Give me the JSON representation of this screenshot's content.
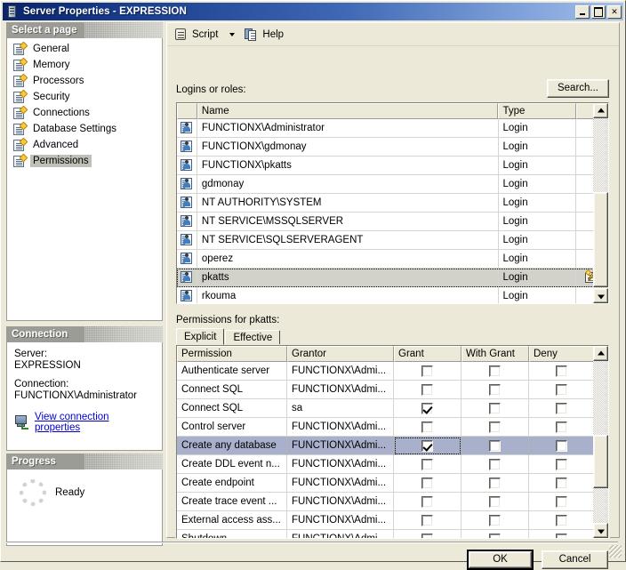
{
  "window": {
    "title": "Server Properties - EXPRESSION",
    "icon": "server-icon",
    "minimize_label": "Minimize",
    "maximize_label": "Maximize",
    "close_label": "✕"
  },
  "sidebar": {
    "header": "Select a page",
    "items": [
      {
        "label": "General",
        "selected": false
      },
      {
        "label": "Memory",
        "selected": false
      },
      {
        "label": "Processors",
        "selected": false
      },
      {
        "label": "Security",
        "selected": false
      },
      {
        "label": "Connections",
        "selected": false
      },
      {
        "label": "Database Settings",
        "selected": false
      },
      {
        "label": "Advanced",
        "selected": false
      },
      {
        "label": "Permissions",
        "selected": true
      }
    ]
  },
  "connection": {
    "header": "Connection",
    "server_label": "Server:",
    "server_value": "EXPRESSION",
    "connection_label": "Connection:",
    "connection_value": "FUNCTIONX\\Administrator",
    "view_properties_link": "View connection properties",
    "link_color": "#0000cd"
  },
  "progress": {
    "header": "Progress",
    "status": "Ready"
  },
  "toolbar": {
    "script_label": "Script",
    "script_icon": "script-icon",
    "script_dropdown_icon": "chevron-down-icon",
    "help_label": "Help",
    "help_icon": "help-icon"
  },
  "logins": {
    "label": "Logins or roles:",
    "search_button": "Search...",
    "columns": [
      "",
      "Name",
      "Type",
      ""
    ],
    "rows": [
      {
        "name": "FUNCTIONX\\Administrator",
        "type": "Login",
        "selected": false,
        "has_edit_icon": false
      },
      {
        "name": "FUNCTIONX\\gdmonay",
        "type": "Login",
        "selected": false,
        "has_edit_icon": false
      },
      {
        "name": "FUNCTIONX\\pkatts",
        "type": "Login",
        "selected": false,
        "has_edit_icon": false
      },
      {
        "name": "gdmonay",
        "type": "Login",
        "selected": false,
        "has_edit_icon": false
      },
      {
        "name": "NT AUTHORITY\\SYSTEM",
        "type": "Login",
        "selected": false,
        "has_edit_icon": false
      },
      {
        "name": "NT SERVICE\\MSSQLSERVER",
        "type": "Login",
        "selected": false,
        "has_edit_icon": false
      },
      {
        "name": "NT SERVICE\\SQLSERVERAGENT",
        "type": "Login",
        "selected": false,
        "has_edit_icon": false
      },
      {
        "name": "operez",
        "type": "Login",
        "selected": false,
        "has_edit_icon": false
      },
      {
        "name": "pkatts",
        "type": "Login",
        "selected": true,
        "has_edit_icon": true
      },
      {
        "name": "rkouma",
        "type": "Login",
        "selected": false,
        "has_edit_icon": false
      }
    ]
  },
  "permissions": {
    "label": "Permissions for pkatts:",
    "tabs": [
      {
        "label": "Explicit",
        "active": true
      },
      {
        "label": "Effective",
        "active": false
      }
    ],
    "columns": [
      "Permission",
      "Grantor",
      "Grant",
      "With Grant",
      "Deny"
    ],
    "rows": [
      {
        "permission": "Authenticate server",
        "grantor": "FUNCTIONX\\Admi...",
        "grant": false,
        "with_grant": false,
        "deny": false,
        "selected": false,
        "focus": false
      },
      {
        "permission": "Connect SQL",
        "grantor": "FUNCTIONX\\Admi...",
        "grant": false,
        "with_grant": false,
        "deny": false,
        "selected": false,
        "focus": false
      },
      {
        "permission": "Connect SQL",
        "grantor": "sa",
        "grant": true,
        "with_grant": false,
        "deny": false,
        "selected": false,
        "focus": false
      },
      {
        "permission": "Control server",
        "grantor": "FUNCTIONX\\Admi...",
        "grant": false,
        "with_grant": false,
        "deny": false,
        "selected": false,
        "focus": false
      },
      {
        "permission": "Create any database",
        "grantor": "FUNCTIONX\\Admi...",
        "grant": true,
        "with_grant": false,
        "deny": false,
        "selected": true,
        "focus": true
      },
      {
        "permission": "Create DDL event n...",
        "grantor": "FUNCTIONX\\Admi...",
        "grant": false,
        "with_grant": false,
        "deny": false,
        "selected": false,
        "focus": false
      },
      {
        "permission": "Create endpoint",
        "grantor": "FUNCTIONX\\Admi...",
        "grant": false,
        "with_grant": false,
        "deny": false,
        "selected": false,
        "focus": false
      },
      {
        "permission": "Create trace event ...",
        "grantor": "FUNCTIONX\\Admi...",
        "grant": false,
        "with_grant": false,
        "deny": false,
        "selected": false,
        "focus": false
      },
      {
        "permission": "External access ass...",
        "grantor": "FUNCTIONX\\Admi...",
        "grant": false,
        "with_grant": false,
        "deny": false,
        "selected": false,
        "focus": false
      },
      {
        "permission": "Shutdown",
        "grantor": "FUNCTIONX\\Admi...",
        "grant": false,
        "with_grant": false,
        "deny": false,
        "selected": false,
        "focus": false
      }
    ]
  },
  "footer": {
    "ok_label": "OK",
    "cancel_label": "Cancel"
  }
}
